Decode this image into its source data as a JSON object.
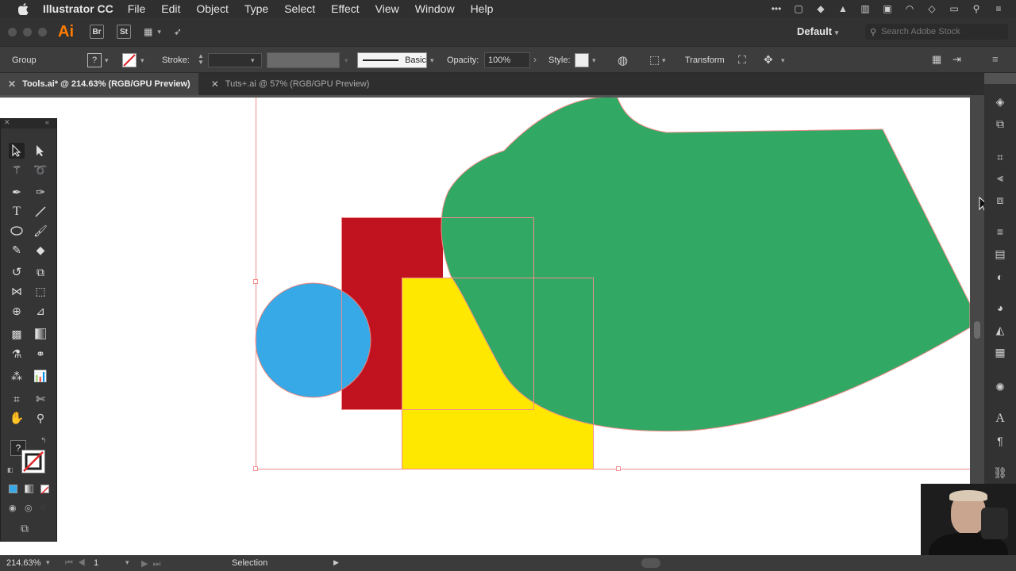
{
  "menubar": {
    "app_name": "Illustrator CC",
    "items": [
      "File",
      "Edit",
      "Object",
      "Type",
      "Select",
      "Effect",
      "View",
      "Window",
      "Help"
    ]
  },
  "appbar": {
    "logo": "Ai",
    "br_label": "Br",
    "st_label": "St",
    "workspace": "Default",
    "search_placeholder": "Search Adobe Stock"
  },
  "control_bar": {
    "selection_type": "Group",
    "stroke_label": "Stroke:",
    "brush_profile": "Basic",
    "opacity_label": "Opacity:",
    "opacity_value": "100%",
    "style_label": "Style:",
    "transform_label": "Transform"
  },
  "tabs": [
    {
      "label": "Tools.ai* @ 214.63% (RGB/GPU Preview)",
      "active": true
    },
    {
      "label": "Tuts+.ai @ 57% (RGB/GPU Preview)",
      "active": false
    }
  ],
  "toolbar": {
    "help_glyph": "?"
  },
  "status_bar": {
    "zoom": "214.63%",
    "artboard_number": "1",
    "current_tool": "Selection"
  },
  "colors": {
    "red_shape": "#c1121f",
    "yellow_shape": "#ffe800",
    "blue_shape": "#36a9e6",
    "green_shape": "#31a964",
    "selection": "#f28b8b",
    "ai_orange": "#ff7c00"
  }
}
